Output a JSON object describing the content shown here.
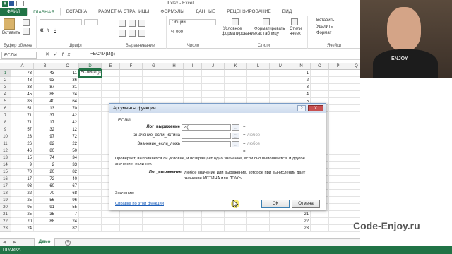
{
  "window": {
    "title": "Il.xlsx - Excel"
  },
  "ribbon_tabs": [
    "ФАЙЛ",
    "ГЛАВНАЯ",
    "ВСТАВКА",
    "РАЗМЕТКА СТРАНИЦЫ",
    "ФОРМУЛЫ",
    "ДАННЫЕ",
    "РЕЦЕНЗИРОВАНИЕ",
    "ВИД"
  ],
  "ribbon": {
    "paste_label": "Вставить",
    "clipboard_label": "Буфер обмена",
    "font_label": "Шрифт",
    "alignment_label": "Выравнивание",
    "number_label": "Число",
    "number_format": "Общий",
    "styles_label": "Стили",
    "cond_format_line1": "Условное",
    "cond_format_line2": "форматирование",
    "format_table_line1": "Форматировать",
    "format_table_line2": "как таблицу",
    "cell_styles_line1": "Стили",
    "cell_styles_line2": "ячеек",
    "insert_label": "Вставить",
    "delete_label": "Удалить",
    "format_label": "Формат",
    "cells_label": "Ячейки"
  },
  "formula_bar": {
    "name_box": "ЕСЛИ",
    "formula": "=ЕСЛИ(И())"
  },
  "columns": [
    "A",
    "B",
    "C",
    "D",
    "E",
    "F",
    "G",
    "H",
    "I",
    "J",
    "K",
    "L",
    "M",
    "N",
    "O",
    "P",
    "Q"
  ],
  "active_column": "D",
  "rows": [
    {
      "n": "1",
      "a": "73",
      "b": "43",
      "c": "11",
      "d": "ЕСЛИ(И())"
    },
    {
      "n": "2",
      "a": "43",
      "b": "93",
      "c": "36"
    },
    {
      "n": "3",
      "a": "33",
      "b": "87",
      "c": "31"
    },
    {
      "n": "4",
      "a": "45",
      "b": "88",
      "c": "24"
    },
    {
      "n": "5",
      "a": "86",
      "b": "40",
      "c": "64"
    },
    {
      "n": "6",
      "a": "51",
      "b": "13",
      "c": "70"
    },
    {
      "n": "7",
      "a": "71",
      "b": "37",
      "c": "42"
    },
    {
      "n": "8",
      "a": "71",
      "b": "17",
      "c": "42"
    },
    {
      "n": "9",
      "a": "57",
      "b": "32",
      "c": "12"
    },
    {
      "n": "10",
      "a": "23",
      "b": "97",
      "c": "72"
    },
    {
      "n": "11",
      "a": "26",
      "b": "82",
      "c": "22"
    },
    {
      "n": "12",
      "a": "46",
      "b": "80",
      "c": "50"
    },
    {
      "n": "13",
      "a": "15",
      "b": "74",
      "c": "34"
    },
    {
      "n": "14",
      "a": "9",
      "b": "2",
      "c": "33"
    },
    {
      "n": "15",
      "a": "70",
      "b": "20",
      "c": "82"
    },
    {
      "n": "16",
      "a": "17",
      "b": "72",
      "c": "40"
    },
    {
      "n": "17",
      "a": "93",
      "b": "60",
      "c": "67"
    },
    {
      "n": "18",
      "a": "22",
      "b": "70",
      "c": "68"
    },
    {
      "n": "19",
      "a": "25",
      "b": "56",
      "c": "96"
    },
    {
      "n": "20",
      "a": "95",
      "b": "91",
      "c": "55"
    },
    {
      "n": "21",
      "a": "25",
      "b": "35",
      "c": "7"
    },
    {
      "n": "22",
      "a": "70",
      "b": "88",
      "c": "24"
    },
    {
      "n": "23",
      "a": "24",
      "b": "",
      "c": "82"
    }
  ],
  "dialog": {
    "title": "Аргументы функции",
    "help": "?",
    "close": "X",
    "function_name": "ЕСЛИ",
    "args": [
      {
        "label": "Лог_выражение",
        "value": "И()",
        "result": "",
        "bold": true
      },
      {
        "label": "Значение_если_истина",
        "value": "",
        "result": "любое",
        "bold": false
      },
      {
        "label": "Значение_если_ложь",
        "value": "",
        "result": "любое",
        "bold": false
      }
    ],
    "equals": "=",
    "description": "Проверяет, выполняется ли условие, и возвращает одно значение, если оно выполняется, и другое значение, если нет.",
    "arg_name": "Лог_выражение",
    "arg_description": "любое значение или выражение, которое при вычислении дает значение ИСТИНА или ЛОЖЬ.",
    "result_label": "Значение:",
    "help_link": "Справка по этой функции",
    "ok": "ОК",
    "cancel": "Отмена"
  },
  "sheet_tabs": [
    "Демо"
  ],
  "add_sheet": "+",
  "status": "ПРАВКА",
  "webcam_shirt_text": "ENJOY",
  "watermark": "Code-Enjoy.ru",
  "colors": {
    "excel_green": "#217346",
    "dialog_title": "#cfdcee",
    "close_red": "#c75050"
  }
}
